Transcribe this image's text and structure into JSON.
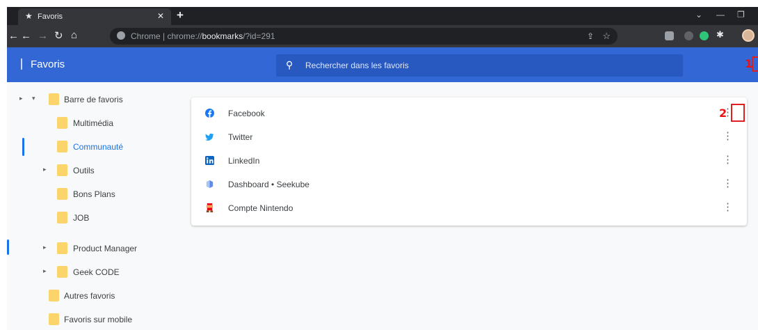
{
  "annotations": {
    "marker1": "1",
    "marker2": "2",
    "tab_marker": "1"
  },
  "browser": {
    "tab_title": "Favoris",
    "url_origin": "Chrome",
    "url_scheme": "chrome://",
    "url_host": "bookmarks",
    "url_path": "/?id=291"
  },
  "header": {
    "title": "Favoris",
    "search_placeholder": "Rechercher dans les favoris"
  },
  "tree": {
    "items": [
      {
        "label": "Barre de favoris"
      },
      {
        "label": "Multimédia"
      },
      {
        "label": "Communauté",
        "selected": true
      },
      {
        "label": "Outils"
      },
      {
        "label": "Bons Plans"
      },
      {
        "label": "JOB"
      },
      {
        "label": "Product Manager"
      },
      {
        "label": "Geek CODE"
      },
      {
        "label": "Autres favoris"
      },
      {
        "label": "Favoris sur mobile"
      }
    ]
  },
  "list": {
    "items": [
      {
        "label": "Facebook",
        "icon": "facebook-icon",
        "color": "#1877f2"
      },
      {
        "label": "Twitter",
        "icon": "twitter-icon",
        "color": "#1da1f2"
      },
      {
        "label": "LinkedIn",
        "icon": "linkedin-icon",
        "color": "#0a66c2"
      },
      {
        "label": "Dashboard • Seekube",
        "icon": "seekube-icon",
        "color": "#2f80ed"
      },
      {
        "label": "Compte Nintendo",
        "icon": "nintendo-icon",
        "color": "#e60012"
      }
    ]
  },
  "colors": {
    "header": "#3367d6",
    "accent": "#1a73e8",
    "folder": "#fbd56b"
  }
}
